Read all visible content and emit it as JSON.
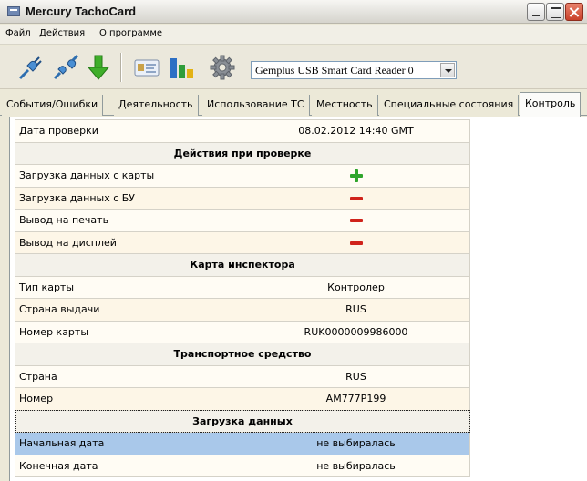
{
  "window": {
    "title": "Mercury TachoCard"
  },
  "menu": [
    "Файл",
    "Действия",
    "О программе"
  ],
  "toolbar": {
    "buttons": [
      "connect-icon",
      "disconnect-icon",
      "download-icon",
      "card-icon",
      "chart-icon",
      "settings-icon"
    ],
    "reader_value": "Gemplus USB Smart Card Reader 0"
  },
  "tabs": [
    "События/Ошибки",
    "Деятельность",
    "Использование ТС",
    "Местность",
    "Специальные состояния",
    "Контроль"
  ],
  "active_tab": "Контроль",
  "table": {
    "check_date_label": "Дата проверки",
    "check_date_value": "08.02.2012    14:40 GMT",
    "section_actions": "Действия при проверке",
    "actions": [
      {
        "label": "Загрузка данных с карты",
        "status": "plus"
      },
      {
        "label": "Загрузка данных с БУ",
        "status": "minus"
      },
      {
        "label": "Вывод на печать",
        "status": "minus"
      },
      {
        "label": "Вывод на дисплей",
        "status": "minus"
      }
    ],
    "section_card": "Карта инспектора",
    "card": [
      {
        "label": "Тип карты",
        "value": "Контролер"
      },
      {
        "label": "Страна выдачи",
        "value": "RUS"
      },
      {
        "label": "Номер карты",
        "value": "RUK0000009986000"
      }
    ],
    "section_vehicle": "Транспортное средство",
    "vehicle": [
      {
        "label": "Страна",
        "value": "RUS"
      },
      {
        "label": "Номер",
        "value": "AM777P199"
      }
    ],
    "section_download": "Загрузка данных",
    "download": [
      {
        "label": "Начальная дата",
        "value": "не выбиралась"
      },
      {
        "label": "Конечная дата",
        "value": "не выбиралась"
      }
    ]
  },
  "colors": {
    "plus": "#2fa52c",
    "minus": "#d0231b",
    "selected_row": "#a9c8ea"
  }
}
